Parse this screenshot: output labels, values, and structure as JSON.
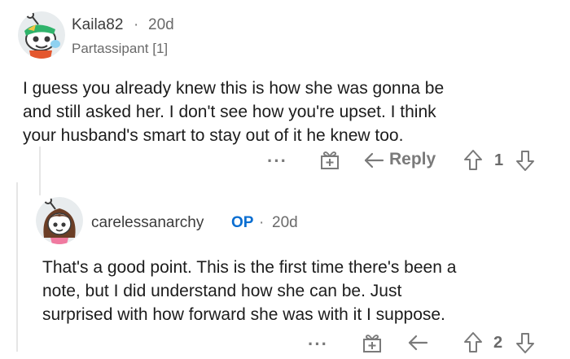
{
  "comment1": {
    "username": "Kaila82",
    "separator": "·",
    "age": "20d",
    "flair": "Partassipant [1]",
    "body_lines": [
      "I guess you already knew this is how she was gonna be",
      "and still asked her. I don't see how you're upset. I think",
      "your husband's smart to stay out of it he knew too."
    ],
    "actions": {
      "more": "···",
      "reply": "Reply",
      "score": "1"
    }
  },
  "comment2": {
    "username": "carelessanarchy",
    "op_badge": "OP",
    "separator": "·",
    "age": "20d",
    "body_lines": [
      "That's a good point. This is the first time there's been a",
      "note, but I did understand how she can be. Just",
      "surprised with how forward she was with it I suppose."
    ],
    "actions": {
      "more": "···",
      "score": "2"
    }
  }
}
